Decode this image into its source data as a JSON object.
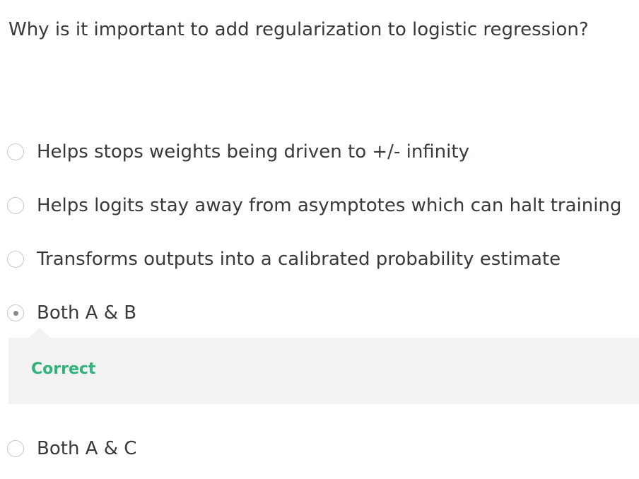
{
  "question": {
    "text": "Why is it important to add regularization to logistic regression?"
  },
  "options": [
    {
      "label": "Helps stops weights being driven to +/- infinity",
      "selected": false
    },
    {
      "label": "Helps logits stay away from asymptotes which can halt training",
      "selected": false
    },
    {
      "label": "Transforms outputs into a calibrated probability estimate",
      "selected": false
    },
    {
      "label": "Both A & B",
      "selected": true
    },
    {
      "label": "Both A & C",
      "selected": false
    }
  ],
  "feedback": {
    "text": "Correct",
    "color": "#2fb37a"
  }
}
